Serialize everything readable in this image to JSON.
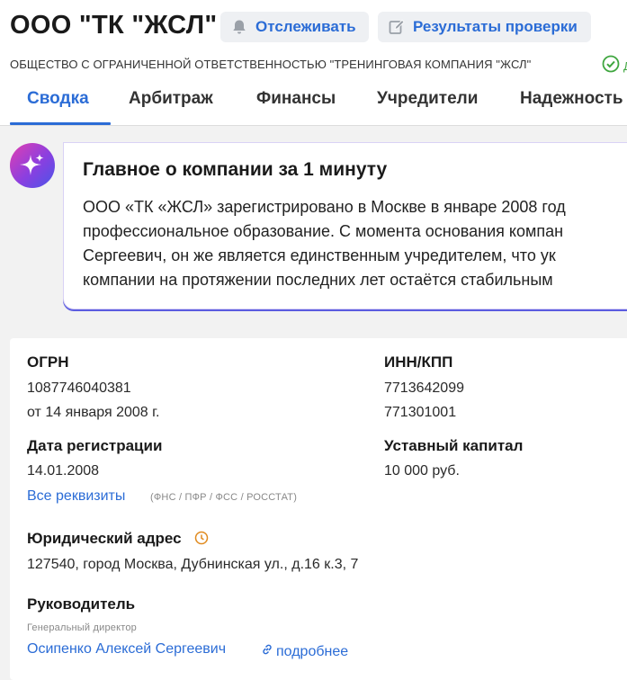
{
  "header": {
    "title": "ООО \"ТК \"ЖСЛ\"",
    "track_label": "Отслеживать",
    "results_label": "Результаты проверки",
    "full_name": "ОБЩЕСТВО С ОГРАНИЧЕННОЙ ОТВЕТСТВЕННОСТЬЮ \"ТРЕНИНГОВАЯ КОМПАНИЯ \"ЖСЛ\"",
    "status_text": "Д"
  },
  "tabs": [
    {
      "label": "Сводка",
      "active": true
    },
    {
      "label": "Арбитраж"
    },
    {
      "label": "Финансы"
    },
    {
      "label": "Учредители"
    },
    {
      "label": "Надежность"
    }
  ],
  "ai_summary": {
    "title": "Главное о компании за 1 минуту",
    "lines": [
      "ООО «ТК «ЖСЛ» зарегистрировано в Москве в январе 2008 год",
      "профессиональное образование. С момента основания компан",
      "Сергеевич, он же является единственным учредителем, что ук",
      "компании на протяжении последних лет остаётся стабильным"
    ]
  },
  "requisites": {
    "ogrn_label": "ОГРН",
    "ogrn_value": "1087746040381",
    "ogrn_date": "от 14 января 2008 г.",
    "inn_label": "ИНН/КПП",
    "inn_value": "7713642099",
    "kpp_value": "771301001",
    "reg_date_label": "Дата регистрации",
    "reg_date_value": "14.01.2008",
    "capital_label": "Уставный капитал",
    "capital_value": "10 000 руб.",
    "all_requisites_link": "Все реквизиты",
    "all_requisites_note": "(ФНС / ПФР / ФСС / РОССТАТ)"
  },
  "address": {
    "label": "Юридический адрес",
    "value": "127540, город Москва, Дубнинская ул., д.16 к.3, 7"
  },
  "head": {
    "label": "Руководитель",
    "position": "Генеральный директор",
    "name": "Осипенко Алексей Сергеевич",
    "more_link": "подробнее"
  },
  "colors": {
    "accent": "#2b6cd6",
    "success": "#3fa63f",
    "ai_gradient_start": "#e23fb0",
    "ai_gradient_end": "#4a55e8",
    "clock_icon": "#e08a1e"
  },
  "icons": {
    "track": "bell-icon",
    "results": "edit-icon",
    "verified": "check-circle-icon",
    "ai": "sparkle-icon",
    "address_history": "clock-icon",
    "more": "link-icon"
  }
}
